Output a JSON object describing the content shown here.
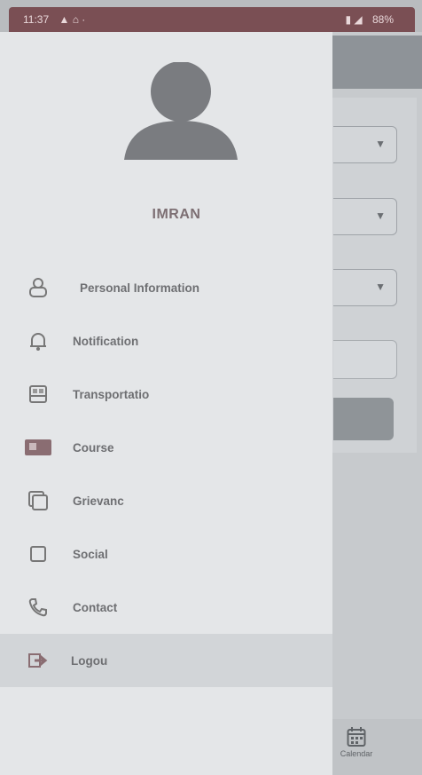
{
  "status_bar": {
    "time": "11:37",
    "battery": "88%"
  },
  "user": {
    "name": "IMRAN"
  },
  "menu": [
    {
      "label": "Personal Information",
      "icon": "user-icon"
    },
    {
      "label": "Notification",
      "icon": "bell-icon"
    },
    {
      "label": "Transportatio",
      "icon": "bus-icon"
    },
    {
      "label": "Course",
      "icon": "course-icon"
    },
    {
      "label": "Grievanc",
      "icon": "copy-icon"
    },
    {
      "label": "Social",
      "icon": "square-icon"
    },
    {
      "label": "Contact",
      "icon": "phone-icon"
    },
    {
      "label": "Logou",
      "icon": "logout-icon",
      "active": true
    }
  ],
  "bottom_nav": {
    "calendar_label": "Calendar"
  },
  "colors": {
    "status_bar": "#7a4f54",
    "drawer_bg": "#e4e6e8",
    "accent": "#8a6d72"
  }
}
